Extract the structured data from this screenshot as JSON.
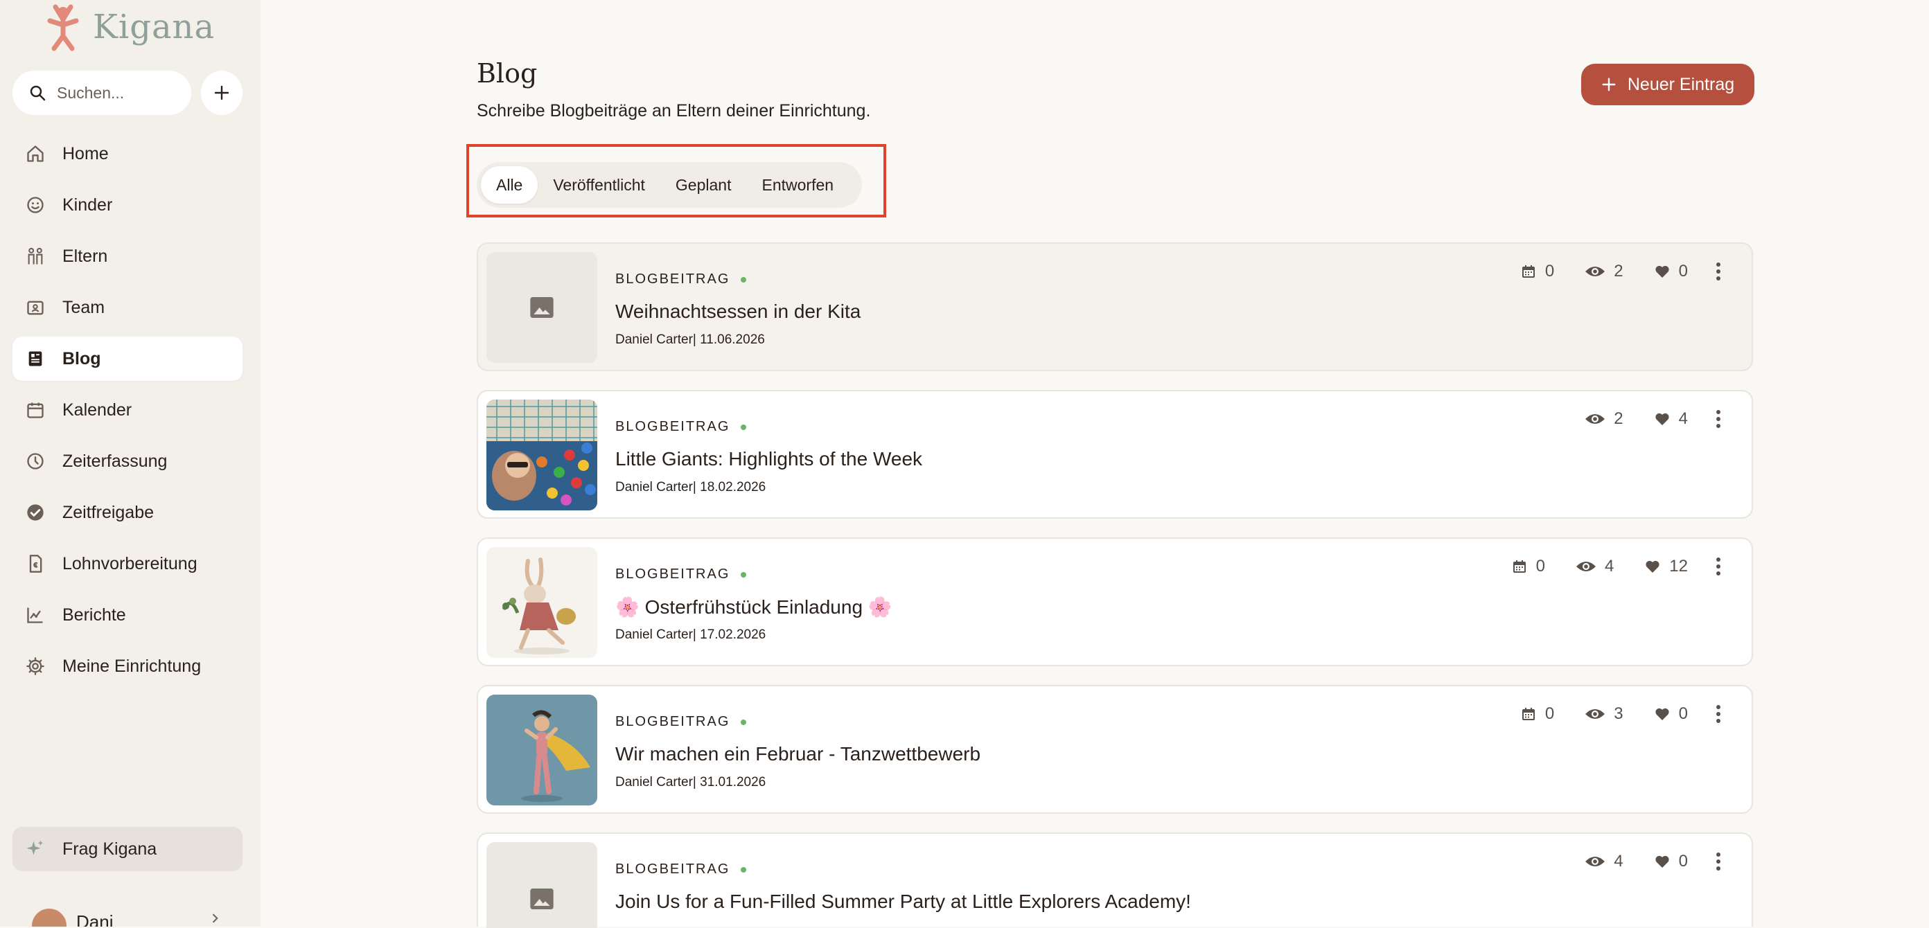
{
  "app": {
    "logo_text": "Kigana"
  },
  "search": {
    "placeholder": "Suchen..."
  },
  "sidebar": {
    "items": [
      {
        "label": "Home",
        "icon": "home-icon"
      },
      {
        "label": "Kinder",
        "icon": "smiley-icon"
      },
      {
        "label": "Eltern",
        "icon": "family-icon"
      },
      {
        "label": "Team",
        "icon": "badge-icon"
      },
      {
        "label": "Blog",
        "icon": "blog-icon",
        "active": true
      },
      {
        "label": "Kalender",
        "icon": "calendar-icon"
      },
      {
        "label": "Zeiterfassung",
        "icon": "clock-icon"
      },
      {
        "label": "Zeitfreigabe",
        "icon": "check-circle-icon"
      },
      {
        "label": "Lohnvorbereitung",
        "icon": "payroll-icon"
      },
      {
        "label": "Berichte",
        "icon": "chart-icon"
      },
      {
        "label": "Meine Einrichtung",
        "icon": "gear-icon"
      }
    ],
    "frag_label": "Frag Kigana",
    "user_name": "Dani"
  },
  "main": {
    "title": "Blog",
    "subtitle": "Schreibe Blogbeiträge an Eltern deiner Einrichtung.",
    "new_button": "Neuer Eintrag",
    "tabs": [
      "Alle",
      "Veröffentlicht",
      "Geplant",
      "Entworfen"
    ],
    "active_tab": "Alle"
  },
  "posts": [
    {
      "type": "BLOGBEITRAG",
      "title": "Weihnachtsessen in der Kita",
      "meta": "Daniel Carter| 11.06.2026",
      "calendar": "0",
      "views": "2",
      "likes": "0",
      "image": "placeholder"
    },
    {
      "type": "BLOGBEITRAG",
      "title": "Little Giants: Highlights of the Week",
      "meta": "Daniel Carter| 18.02.2026",
      "views": "2",
      "likes": "4",
      "image": "ballpit-photo"
    },
    {
      "type": "BLOGBEITRAG",
      "title": "🌸 Osterfrühstück Einladung 🌸",
      "meta": "Daniel Carter| 17.02.2026",
      "calendar": "0",
      "views": "4",
      "likes": "12",
      "image": "bunny-illustration"
    },
    {
      "type": "BLOGBEITRAG",
      "title": "Wir machen ein Februar - Tanzwettbewerb",
      "meta": "Daniel Carter| 31.01.2026",
      "calendar": "0",
      "views": "3",
      "likes": "0",
      "image": "superhero-photo"
    },
    {
      "type": "BLOGBEITRAG",
      "title": "Join Us for a Fun-Filled Summer Party at Little Explorers Academy!",
      "meta": "",
      "views": "4",
      "likes": "0",
      "image": "placeholder"
    }
  ],
  "colors": {
    "accent": "#b5503e",
    "sidebar_bg": "#f3efe9",
    "page_bg": "#faf8f5",
    "status_dot": "#6ab46a",
    "highlight": "#e0432b"
  }
}
